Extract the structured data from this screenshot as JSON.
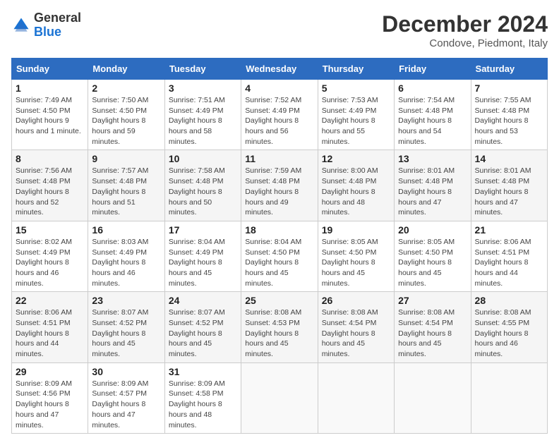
{
  "header": {
    "logo_general": "General",
    "logo_blue": "Blue",
    "month_year": "December 2024",
    "location": "Condove, Piedmont, Italy"
  },
  "weekdays": [
    "Sunday",
    "Monday",
    "Tuesday",
    "Wednesday",
    "Thursday",
    "Friday",
    "Saturday"
  ],
  "weeks": [
    [
      {
        "day": "1",
        "sunrise": "7:49 AM",
        "sunset": "4:50 PM",
        "daylight": "9 hours and 1 minute."
      },
      {
        "day": "2",
        "sunrise": "7:50 AM",
        "sunset": "4:50 PM",
        "daylight": "8 hours and 59 minutes."
      },
      {
        "day": "3",
        "sunrise": "7:51 AM",
        "sunset": "4:49 PM",
        "daylight": "8 hours and 58 minutes."
      },
      {
        "day": "4",
        "sunrise": "7:52 AM",
        "sunset": "4:49 PM",
        "daylight": "8 hours and 56 minutes."
      },
      {
        "day": "5",
        "sunrise": "7:53 AM",
        "sunset": "4:49 PM",
        "daylight": "8 hours and 55 minutes."
      },
      {
        "day": "6",
        "sunrise": "7:54 AM",
        "sunset": "4:48 PM",
        "daylight": "8 hours and 54 minutes."
      },
      {
        "day": "7",
        "sunrise": "7:55 AM",
        "sunset": "4:48 PM",
        "daylight": "8 hours and 53 minutes."
      }
    ],
    [
      {
        "day": "8",
        "sunrise": "7:56 AM",
        "sunset": "4:48 PM",
        "daylight": "8 hours and 52 minutes."
      },
      {
        "day": "9",
        "sunrise": "7:57 AM",
        "sunset": "4:48 PM",
        "daylight": "8 hours and 51 minutes."
      },
      {
        "day": "10",
        "sunrise": "7:58 AM",
        "sunset": "4:48 PM",
        "daylight": "8 hours and 50 minutes."
      },
      {
        "day": "11",
        "sunrise": "7:59 AM",
        "sunset": "4:48 PM",
        "daylight": "8 hours and 49 minutes."
      },
      {
        "day": "12",
        "sunrise": "8:00 AM",
        "sunset": "4:48 PM",
        "daylight": "8 hours and 48 minutes."
      },
      {
        "day": "13",
        "sunrise": "8:01 AM",
        "sunset": "4:48 PM",
        "daylight": "8 hours and 47 minutes."
      },
      {
        "day": "14",
        "sunrise": "8:01 AM",
        "sunset": "4:48 PM",
        "daylight": "8 hours and 47 minutes."
      }
    ],
    [
      {
        "day": "15",
        "sunrise": "8:02 AM",
        "sunset": "4:49 PM",
        "daylight": "8 hours and 46 minutes."
      },
      {
        "day": "16",
        "sunrise": "8:03 AM",
        "sunset": "4:49 PM",
        "daylight": "8 hours and 46 minutes."
      },
      {
        "day": "17",
        "sunrise": "8:04 AM",
        "sunset": "4:49 PM",
        "daylight": "8 hours and 45 minutes."
      },
      {
        "day": "18",
        "sunrise": "8:04 AM",
        "sunset": "4:50 PM",
        "daylight": "8 hours and 45 minutes."
      },
      {
        "day": "19",
        "sunrise": "8:05 AM",
        "sunset": "4:50 PM",
        "daylight": "8 hours and 45 minutes."
      },
      {
        "day": "20",
        "sunrise": "8:05 AM",
        "sunset": "4:50 PM",
        "daylight": "8 hours and 45 minutes."
      },
      {
        "day": "21",
        "sunrise": "8:06 AM",
        "sunset": "4:51 PM",
        "daylight": "8 hours and 44 minutes."
      }
    ],
    [
      {
        "day": "22",
        "sunrise": "8:06 AM",
        "sunset": "4:51 PM",
        "daylight": "8 hours and 44 minutes."
      },
      {
        "day": "23",
        "sunrise": "8:07 AM",
        "sunset": "4:52 PM",
        "daylight": "8 hours and 45 minutes."
      },
      {
        "day": "24",
        "sunrise": "8:07 AM",
        "sunset": "4:52 PM",
        "daylight": "8 hours and 45 minutes."
      },
      {
        "day": "25",
        "sunrise": "8:08 AM",
        "sunset": "4:53 PM",
        "daylight": "8 hours and 45 minutes."
      },
      {
        "day": "26",
        "sunrise": "8:08 AM",
        "sunset": "4:54 PM",
        "daylight": "8 hours and 45 minutes."
      },
      {
        "day": "27",
        "sunrise": "8:08 AM",
        "sunset": "4:54 PM",
        "daylight": "8 hours and 45 minutes."
      },
      {
        "day": "28",
        "sunrise": "8:08 AM",
        "sunset": "4:55 PM",
        "daylight": "8 hours and 46 minutes."
      }
    ],
    [
      {
        "day": "29",
        "sunrise": "8:09 AM",
        "sunset": "4:56 PM",
        "daylight": "8 hours and 47 minutes."
      },
      {
        "day": "30",
        "sunrise": "8:09 AM",
        "sunset": "4:57 PM",
        "daylight": "8 hours and 47 minutes."
      },
      {
        "day": "31",
        "sunrise": "8:09 AM",
        "sunset": "4:58 PM",
        "daylight": "8 hours and 48 minutes."
      },
      null,
      null,
      null,
      null
    ]
  ],
  "labels": {
    "sunrise": "Sunrise:",
    "sunset": "Sunset:",
    "daylight": "Daylight hours"
  }
}
